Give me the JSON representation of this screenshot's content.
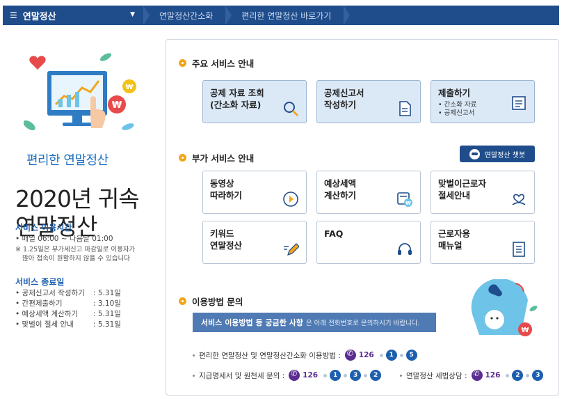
{
  "topbar": {
    "menu_label": "연말정산",
    "breadcrumbs": [
      "연말정산간소화",
      "편리한 연말정산 바로가기"
    ]
  },
  "left": {
    "brand": "편리한 연말정산",
    "title_line1": "2020년 귀속",
    "title_line2": "연말정산",
    "service_time": {
      "title": "서비스 이용시간",
      "line": "• 매일 06:00 ~ 다음날 01:00",
      "note1": "※ 1.25일은 부가세신고 마감일로 이용자가",
      "note2": "많아 접속이 원활하지 않을 수 있습니다"
    },
    "service_end": {
      "title": "서비스 종료일",
      "items": [
        {
          "name": "• 공제신고서 작성하기",
          "date": ": 5.31일"
        },
        {
          "name": "• 간편제출하기",
          "date": ": 3.10일"
        },
        {
          "name": "• 예상세액 계산하기",
          "date": ": 5.31일"
        },
        {
          "name": "• 맞벌이 절세 안내",
          "date": ": 5.31일"
        }
      ]
    }
  },
  "main": {
    "section1": "주요 서비스 안내",
    "main_cards": [
      {
        "label": "공제 자료 조회\n(간소화 자료)",
        "icon": "magnifier-icon"
      },
      {
        "label": "공제신고서\n작성하기",
        "icon": "document-icon"
      },
      {
        "label": "제출하기",
        "sub1": "• 간소화 자료",
        "sub2": "• 공제신고서",
        "icon": "form-icon"
      }
    ],
    "section2": "부가 서비스 안내",
    "chatbot_label": "연말정산 챗봇",
    "sub_cards": [
      {
        "label": "동영상\n따라하기",
        "icon": "play-icon"
      },
      {
        "label": "예상세액\n계산하기",
        "icon": "calculator-icon"
      },
      {
        "label": "맞벌이근로자\n절세안내",
        "icon": "couple-icon"
      },
      {
        "label": "키워드\n연말정산",
        "icon": "pencil-icon"
      },
      {
        "label": "FAQ",
        "icon": "headset-icon"
      },
      {
        "label": "근로자용\n매뉴얼",
        "icon": "manual-icon"
      }
    ],
    "section3": "이용방법 문의",
    "banner_bold": "서비스 이용방법 등 궁금한 사항",
    "banner_rest": "은 아래 전화번호로 문의하시기 바랍니다.",
    "contact1_label": "편리한 연말정산 및 연말정산간소화 이용방법 :",
    "contact1_number": "126",
    "contact1_seq": [
      "1",
      "5"
    ],
    "contact2_label": "지급명세서 및 원천세 문의 :",
    "contact2_number": "126",
    "contact2_seq": [
      "1",
      "3",
      "2"
    ],
    "contact3_label": "연말정산 세법상담 :",
    "contact3_number": "126",
    "contact3_seq": [
      "2",
      "3"
    ]
  }
}
